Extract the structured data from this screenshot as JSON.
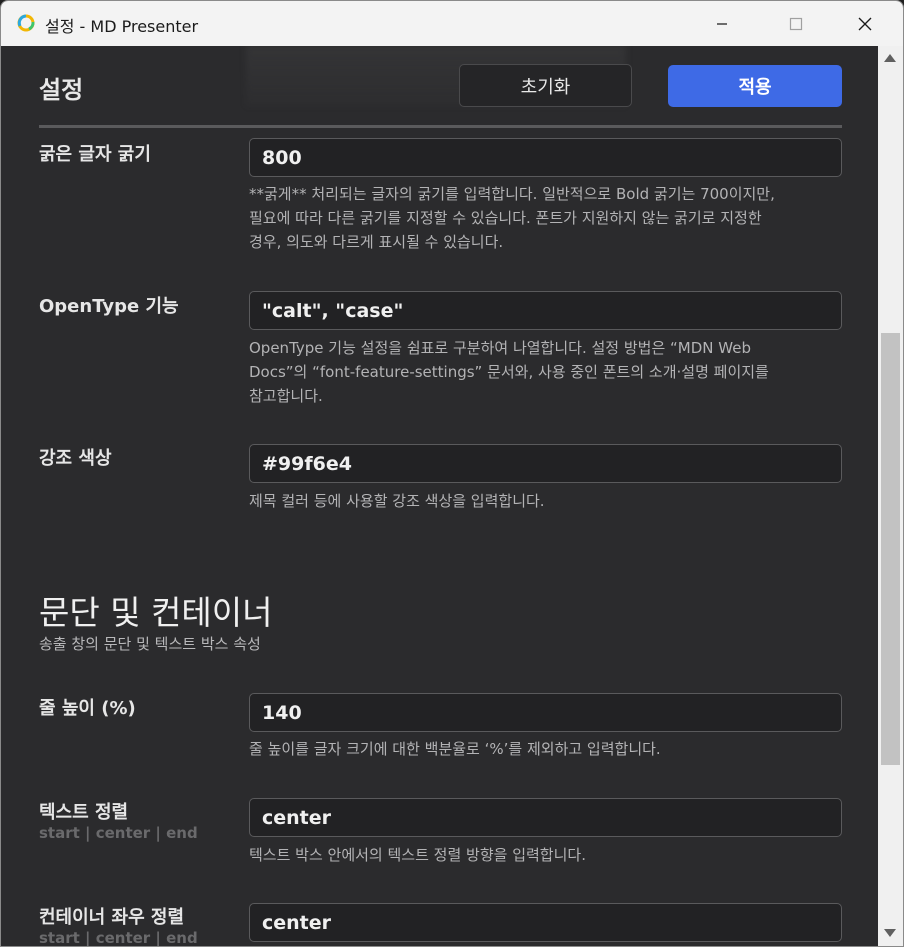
{
  "window": {
    "title": "설정 - MD Presenter",
    "controls": {
      "minimize": "minimize-icon",
      "maximize": "maximize-icon",
      "close": "close-icon"
    }
  },
  "header": {
    "title": "설정",
    "reset_label": "초기화",
    "apply_label": "적용"
  },
  "colors": {
    "accent": "#3e6ae6",
    "background": "#2b2b2d"
  },
  "fields": [
    {
      "label": "굵은 글자 굵기",
      "value": "800",
      "desc_lines": [
        "**굵게** 처리되는 글자의 굵기를 입력합니다. 일반적으로 Bold 굵기는 700이지만,",
        "필요에 따라 다른 굵기를 지정할 수 있습니다. 폰트가 지원하지 않는 굵기로 지정한",
        "경우, 의도와 다르게 표시될 수 있습니다."
      ]
    },
    {
      "label": "OpenType 기능",
      "value": "\"calt\", \"case\"",
      "desc_lines": [
        "OpenType 기능 설정을 쉼표로 구분하여 나열합니다. 설정 방법은 “MDN Web",
        "Docs”의 “font-feature-settings” 문서와, 사용 중인 폰트의 소개·설명 페이지를",
        "참고합니다."
      ]
    },
    {
      "label": "강조 색상",
      "value": "#99f6e4",
      "desc_lines": [
        "제목 컬러 등에 사용할 강조 색상을 입력합니다."
      ]
    }
  ],
  "section": {
    "title": "문단 및 컨테이너",
    "subtitle": "송출 창의 문단 및 텍스트 박스 속성",
    "fields": [
      {
        "label": "줄 높이 (%)",
        "value": "140",
        "desc_lines": [
          "줄 높이를 글자 크기에 대한 백분율로 ‘%’를 제외하고 입력합니다."
        ]
      },
      {
        "label": "텍스트 정렬",
        "sublabel": "start | center | end",
        "value": "center",
        "desc_lines": [
          "텍스트 박스 안에서의 텍스트 정렬 방향을 입력합니다."
        ]
      },
      {
        "label": "컨테이너 좌우 정렬",
        "sublabel": "start | center | end",
        "value": "center"
      }
    ]
  }
}
